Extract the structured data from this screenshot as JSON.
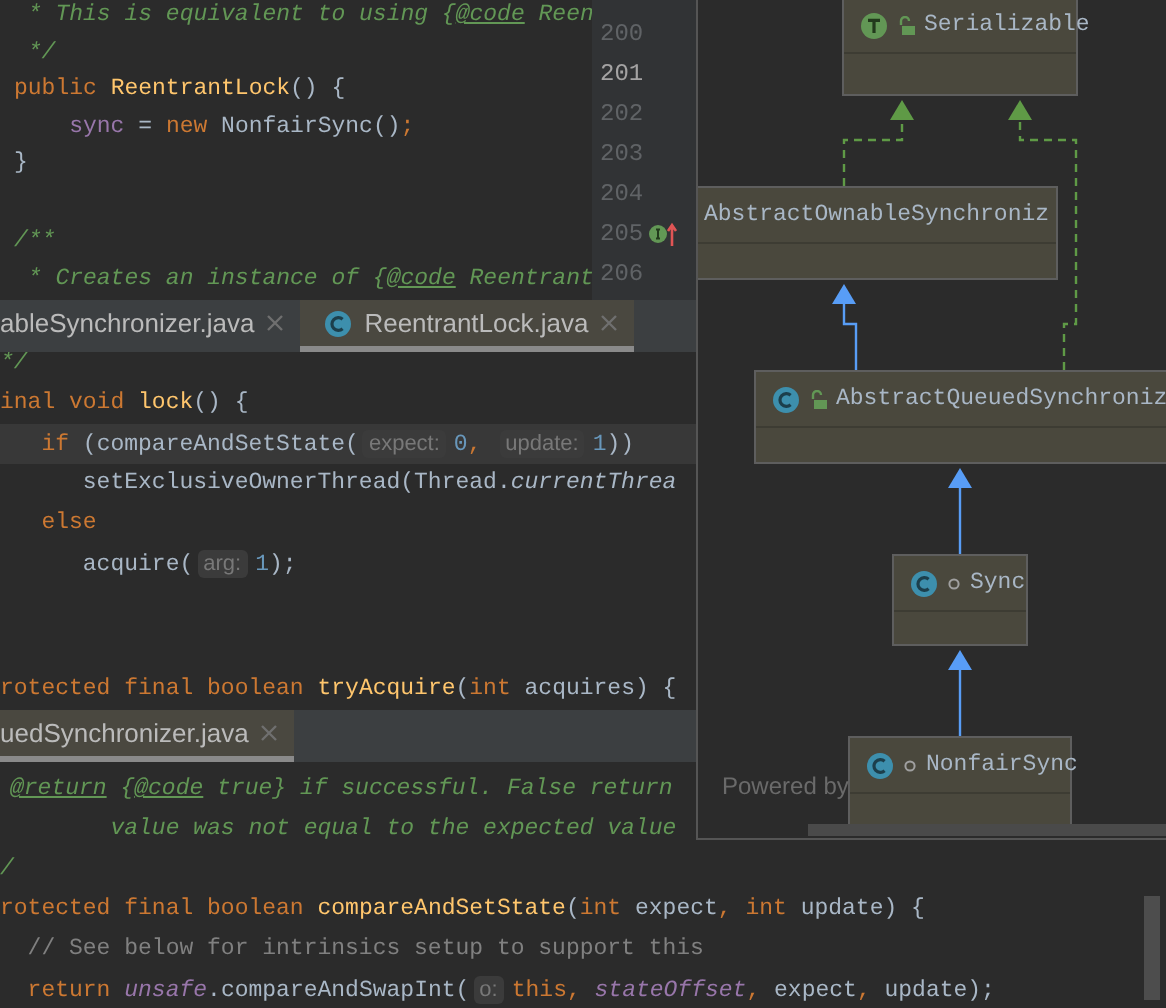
{
  "editor_top": {
    "lines": [
      {
        "tokens": [
          {
            "kind": "comment",
            "text": " * This is equivalent to using {"
          },
          {
            "kind": "doctag",
            "text": "@code"
          },
          {
            "kind": "comment",
            "text": " Reen"
          }
        ]
      },
      {
        "tokens": [
          {
            "kind": "comment",
            "text": " */"
          }
        ]
      },
      {
        "tokens": [
          {
            "kind": "kw",
            "text": "public "
          },
          {
            "kind": "fn",
            "text": "ReentrantLock"
          },
          {
            "kind": "plain",
            "text": "() {"
          }
        ]
      },
      {
        "tokens": [
          {
            "kind": "field",
            "text": "    sync"
          },
          {
            "kind": "plain",
            "text": " = "
          },
          {
            "kind": "kw",
            "text": "new "
          },
          {
            "kind": "plain",
            "text": "NonfairSync()"
          },
          {
            "kind": "kw",
            "text": ";"
          }
        ]
      },
      {
        "tokens": [
          {
            "kind": "plain",
            "text": "}"
          }
        ]
      },
      {
        "blank_before": true,
        "tokens": [
          {
            "kind": "comment",
            "text": "/**"
          }
        ]
      },
      {
        "tokens": [
          {
            "kind": "comment",
            "text": " * Creates an instance of {"
          },
          {
            "kind": "doctag",
            "text": "@code"
          },
          {
            "kind": "comment",
            "text": " Reentrant"
          }
        ]
      }
    ],
    "gutter": [
      {
        "number": "200",
        "current": false,
        "marker": false
      },
      {
        "number": "201",
        "current": true,
        "marker": false
      },
      {
        "number": "202",
        "current": false,
        "marker": false
      },
      {
        "number": "203",
        "current": false,
        "marker": false
      },
      {
        "number": "204",
        "current": false,
        "marker": false
      },
      {
        "number": "205",
        "current": false,
        "marker": true
      },
      {
        "number": "206",
        "current": false,
        "marker": false
      }
    ]
  },
  "tabs_middle": [
    {
      "label": "ableSynchronizer.java",
      "selected": false,
      "icon": false
    },
    {
      "label": "ReentrantLock.java",
      "selected": true,
      "icon": true
    }
  ],
  "editor_middle": {
    "lines": [
      {
        "current": false,
        "tokens": [
          {
            "kind": "comment",
            "text": "*/"
          }
        ]
      },
      {
        "current": false,
        "tokens": [
          {
            "kind": "kw",
            "text": "inal void "
          },
          {
            "kind": "fn",
            "text": "lock"
          },
          {
            "kind": "plain",
            "text": "() {"
          }
        ]
      },
      {
        "current": true,
        "tokens": [
          {
            "kind": "kw",
            "text": "   if "
          },
          {
            "kind": "plain",
            "text": "(compareAndSetState("
          },
          {
            "kind": "hint",
            "text": "expect:"
          },
          {
            "kind": "number",
            "text": "0"
          },
          {
            "kind": "kw",
            "text": ", "
          },
          {
            "kind": "hint",
            "text": "update:"
          },
          {
            "kind": "number",
            "text": "1"
          },
          {
            "kind": "plain",
            "text": "))"
          }
        ]
      },
      {
        "current": false,
        "tokens": [
          {
            "kind": "plain",
            "text": "      setExclusiveOwnerThread(Thread."
          },
          {
            "kind": "italic",
            "text": "currentThrea"
          }
        ]
      },
      {
        "current": false,
        "tokens": [
          {
            "kind": "kw",
            "text": "   else"
          }
        ]
      },
      {
        "current": false,
        "tokens": [
          {
            "kind": "plain",
            "text": "      acquire("
          },
          {
            "kind": "hint",
            "text": "arg:"
          },
          {
            "kind": "number",
            "text": "1"
          },
          {
            "kind": "plain",
            "text": ");"
          }
        ]
      },
      {
        "current": false,
        "blank_before": true,
        "tokens": [
          {
            "kind": "kw",
            "text": "rotected final boolean "
          },
          {
            "kind": "fn",
            "text": "tryAcquire"
          },
          {
            "kind": "plain",
            "text": "("
          },
          {
            "kind": "kw",
            "text": "int "
          },
          {
            "kind": "plain",
            "text": "acquires) {"
          }
        ]
      }
    ]
  },
  "tabs_bottom": [
    {
      "label": "uedSynchronizer.java",
      "selected": true,
      "icon": false
    }
  ],
  "editor_bottom": {
    "lines": [
      {
        "tokens": [
          {
            "kind": "doctag",
            "text": "@return"
          },
          {
            "kind": "comment",
            "text": " {"
          },
          {
            "kind": "doctag",
            "text": "@code"
          },
          {
            "kind": "comment",
            "text": " true} if successful. False return"
          }
        ]
      },
      {
        "tokens": [
          {
            "kind": "comment",
            "text": "        value was not equal to the expected value"
          }
        ]
      },
      {
        "tokens": [
          {
            "kind": "comment",
            "text": "/"
          }
        ]
      },
      {
        "tokens": [
          {
            "kind": "kw",
            "text": "rotected final boolean "
          },
          {
            "kind": "fn",
            "text": "compareAndSetState"
          },
          {
            "kind": "plain",
            "text": "("
          },
          {
            "kind": "kw",
            "text": "int "
          },
          {
            "kind": "plain",
            "text": "expect"
          },
          {
            "kind": "kw",
            "text": ", int "
          },
          {
            "kind": "plain",
            "text": "update) {"
          }
        ]
      },
      {
        "tokens": [
          {
            "kind": "line_comment",
            "text": "  // See below for intrinsics setup to support this"
          }
        ]
      },
      {
        "tokens": [
          {
            "kind": "kw",
            "text": "  return "
          },
          {
            "kind": "static_field",
            "text": "unsafe"
          },
          {
            "kind": "plain",
            "text": ".compareAndSwapInt("
          },
          {
            "kind": "hint",
            "text": "o:"
          },
          {
            "kind": "kw",
            "text": "this, "
          },
          {
            "kind": "static_field",
            "text": "stateOffset"
          },
          {
            "kind": "kw",
            "text": ", "
          },
          {
            "kind": "plain",
            "text": "expect"
          },
          {
            "kind": "kw",
            "text": ", "
          },
          {
            "kind": "plain",
            "text": "update);"
          }
        ]
      }
    ]
  },
  "hierarchy_popup": {
    "nodes": [
      {
        "name": "Serializable",
        "kind": "interface"
      },
      {
        "name": "AbstractOwnableSynchroniz",
        "kind": "plain"
      },
      {
        "name": "AbstractQueuedSynchroniz",
        "kind": "abstract"
      },
      {
        "name": "Sync",
        "kind": "nested"
      },
      {
        "name": "NonfairSync",
        "kind": "nested"
      }
    ],
    "edges": [
      {
        "kind": "implements"
      },
      {
        "kind": "implements"
      },
      {
        "kind": "extends"
      },
      {
        "kind": "extends"
      },
      {
        "kind": "extends"
      }
    ],
    "footer": "Powered by"
  }
}
